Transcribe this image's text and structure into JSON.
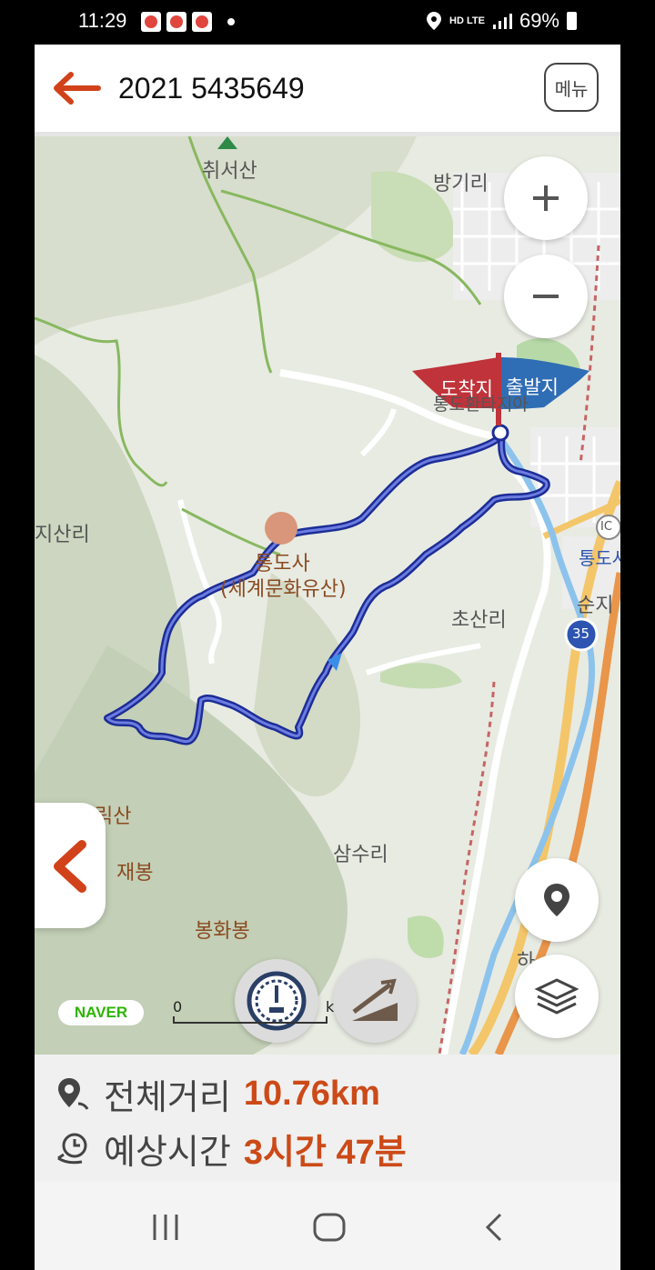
{
  "status_bar": {
    "time": "11:29",
    "network": "HD LTE",
    "battery": "69%"
  },
  "header": {
    "title": "2021 5435649",
    "menu_label": "메뉴"
  },
  "map": {
    "places": {
      "peak_top": "취서산",
      "banggi": "방기리",
      "jisan": "지산리",
      "temple_1": "통도사",
      "temple_2": "(세계문화유산)",
      "chosan": "초산리",
      "samsu": "삼수리",
      "peak_ri": "릭산",
      "peak_jae": "재봉",
      "bonghwa": "봉화봉",
      "tongdo_label": "통도환타지아",
      "ic": "IC",
      "tongdo_right": "통도사",
      "sunji": "순지",
      "route_num": "35",
      "ha": "하"
    },
    "flags": {
      "arrival": "도착지",
      "departure": "출발지"
    },
    "logo": "NAVER",
    "scale": "0",
    "scale_unit": "k"
  },
  "info": {
    "distance_label": "전체거리",
    "distance_value": "10.76km",
    "time_label": "예상시간",
    "time_value": "3시간 47분"
  },
  "colors": {
    "accent": "#cc4a18",
    "route": "#2d3fb8",
    "arrival_flag": "#c0333a",
    "departure_flag": "#2f6db5"
  }
}
